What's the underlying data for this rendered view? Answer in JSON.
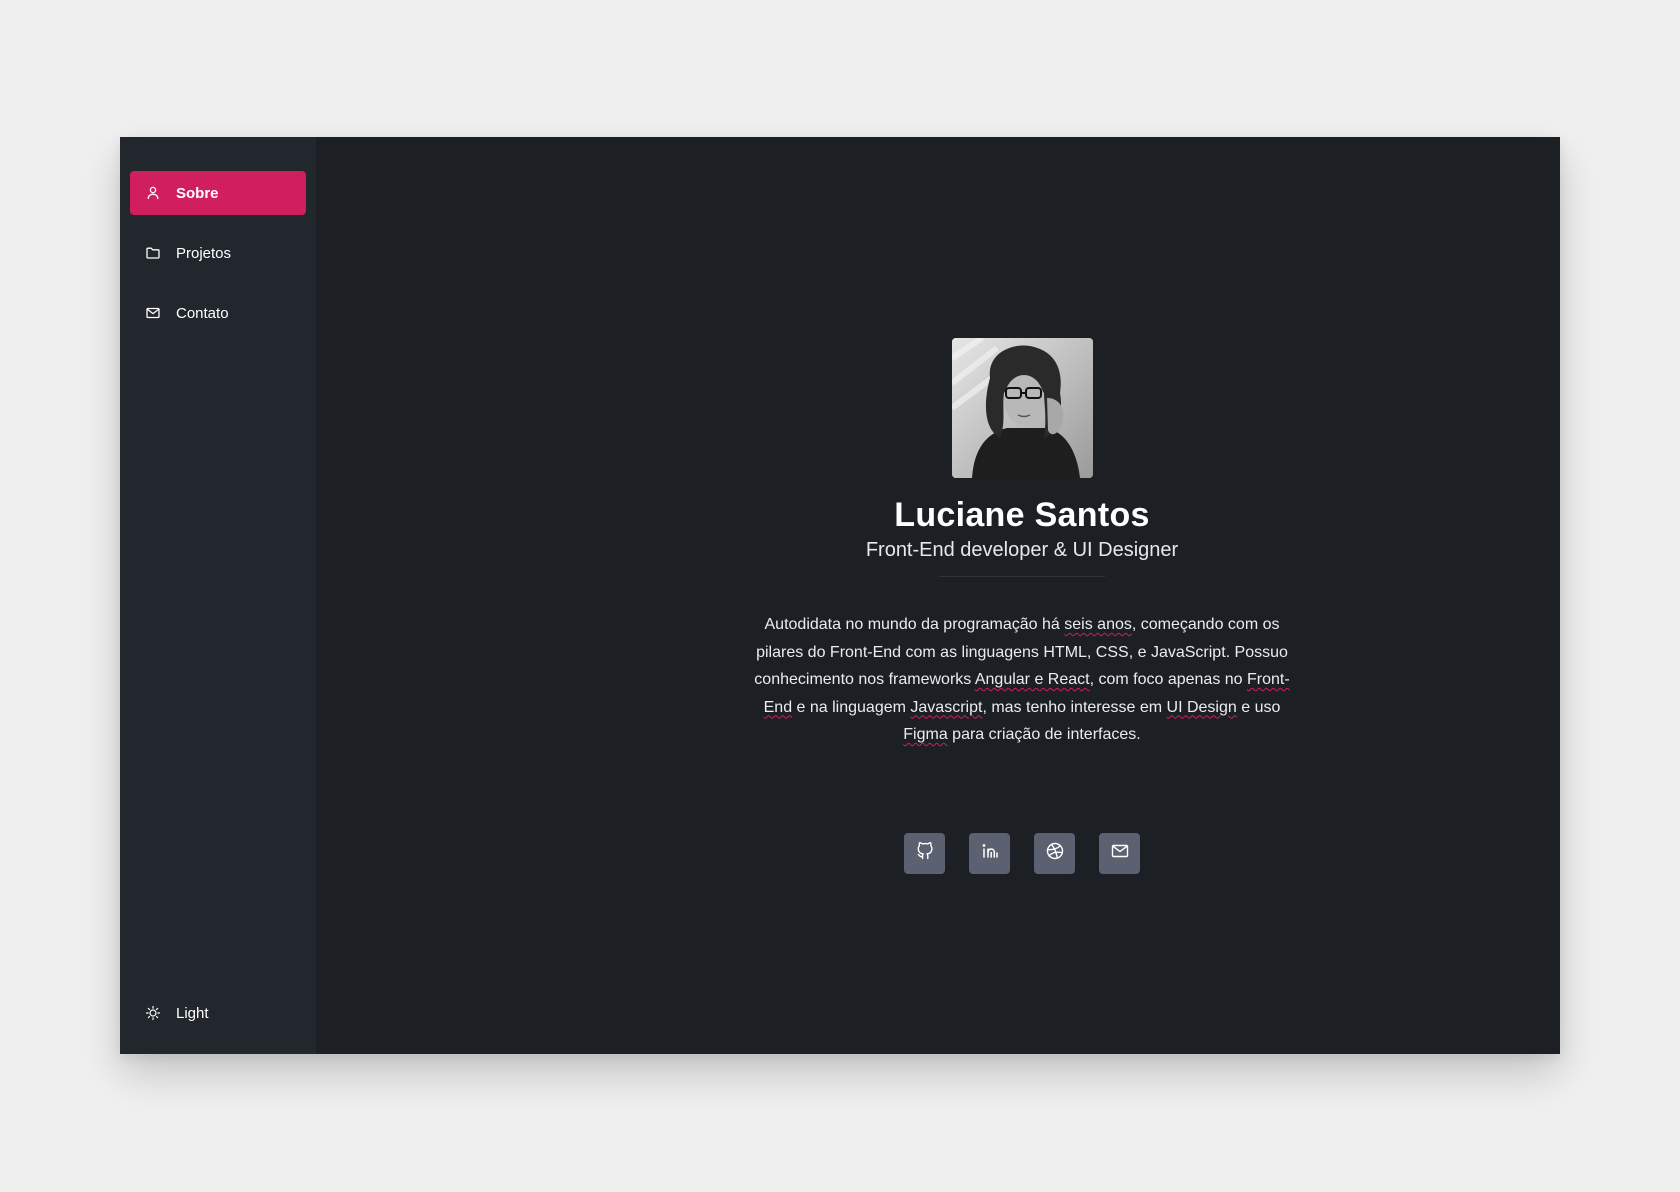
{
  "sidebar": {
    "items": [
      {
        "label": "Sobre",
        "icon": "user-icon",
        "active": true
      },
      {
        "label": "Projetos",
        "icon": "folder-icon",
        "active": false
      },
      {
        "label": "Contato",
        "icon": "mail-icon",
        "active": false
      }
    ],
    "theme_toggle": {
      "label": "Light",
      "icon": "sun-icon"
    }
  },
  "profile": {
    "name": "Luciane Santos",
    "role": "Front-End developer & UI Designer",
    "bio": {
      "p1": "Autodidata no mundo da programação há ",
      "s1": "seis anos",
      "p2": ", começando com os pilares do Front-End com as linguagens HTML, CSS, e JavaScript. Possuo conhecimento nos frameworks ",
      "s2": "Angular e React",
      "p3": ", com foco apenas no ",
      "s3": "Front-End",
      "p4": " e na linguagem ",
      "s4": "Javascript",
      "p5": ", mas tenho interesse em ",
      "s5": "UI Design",
      "p6": " e uso ",
      "s6": "Figma",
      "p7": " para criação de interfaces."
    }
  },
  "socials": [
    {
      "name": "github",
      "icon": "github-icon"
    },
    {
      "name": "linkedin",
      "icon": "linkedin-icon"
    },
    {
      "name": "dribbble",
      "icon": "dribbble-icon"
    },
    {
      "name": "email",
      "icon": "mail-icon"
    }
  ],
  "colors": {
    "accent": "#d11e5c",
    "sidebar_bg": "#22262d",
    "main_bg": "#1c1f24",
    "social_bg": "#5b6170"
  }
}
